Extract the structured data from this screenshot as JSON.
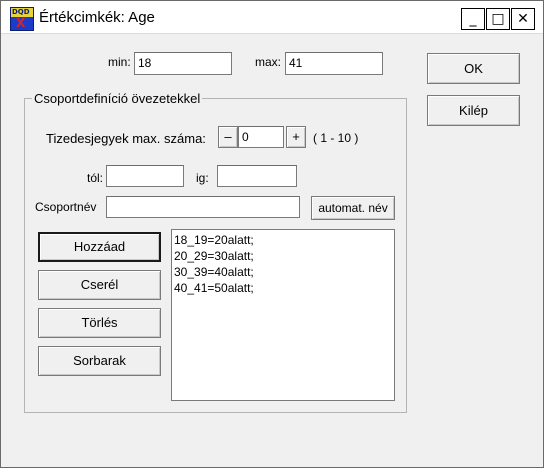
{
  "window": {
    "title": "Értékcimkék: Age",
    "app_icon_text": "DQD",
    "app_icon_mark": "X",
    "minimize_glyph": "_",
    "maximize_glyph": "□",
    "close_glyph": "✕"
  },
  "range": {
    "min_label": "min:",
    "min_value": "18",
    "max_label": "max:",
    "max_value": "41"
  },
  "buttons": {
    "ok": "OK",
    "exit": "Kilép"
  },
  "group": {
    "title": "Csoportdefiníció övezetekkel",
    "decimals_label": "Tizedesjegyek max. száma:",
    "decimals_minus": "–",
    "decimals_value": "0",
    "decimals_plus": "+",
    "decimals_range": "( 1 - 10 )",
    "from_label": "tól:",
    "from_value": "",
    "to_label": "ig:",
    "to_value": "",
    "groupname_label": "Csoportnév",
    "groupname_value": "",
    "auto_name": "automat. név",
    "add": "Hozzáad",
    "replace": "Cserél",
    "delete": "Törlés",
    "sort": "Sorbarak",
    "items": [
      "18_19=20alatt;",
      "20_29=30alatt;",
      "30_39=40alatt;",
      "40_41=50alatt;"
    ]
  }
}
